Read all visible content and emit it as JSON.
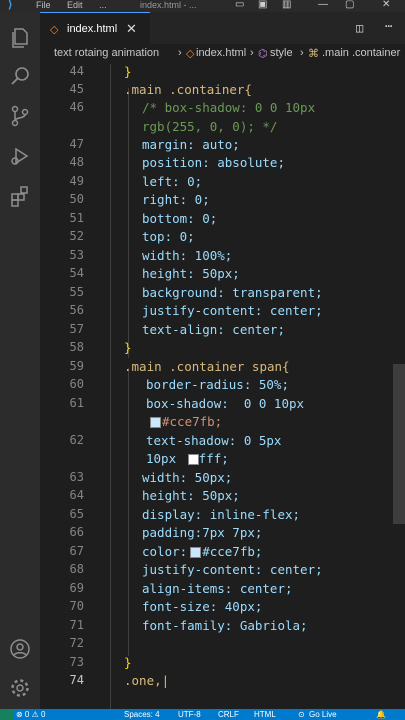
{
  "titlebar": {
    "menu": [
      "File",
      "Edit",
      "..."
    ],
    "window_title": "index.html - ..."
  },
  "tabs": [
    {
      "label": "index.html",
      "close": "✕"
    }
  ],
  "breadcrumb": [
    "text rotaing animation",
    "index.html",
    "style",
    ".main .container"
  ],
  "editor": {
    "lines": [
      {
        "n": "44",
        "text": "}"
      },
      {
        "n": "45",
        "text": ".main .container{"
      },
      {
        "n": "46",
        "text": "/* box-shadow: 0 0 10px"
      },
      {
        "n": "",
        "text": "rgb(255, 0, 0); */"
      },
      {
        "n": "47",
        "text": "margin: auto;"
      },
      {
        "n": "48",
        "text": "position: absolute;"
      },
      {
        "n": "49",
        "text": "left: 0;"
      },
      {
        "n": "50",
        "text": "right: 0;"
      },
      {
        "n": "51",
        "text": "bottom: 0;"
      },
      {
        "n": "52",
        "text": "top: 0;"
      },
      {
        "n": "53",
        "text": "width: 100%;"
      },
      {
        "n": "54",
        "text": "height: 50px;"
      },
      {
        "n": "55",
        "text": "background: transparent;"
      },
      {
        "n": "56",
        "text": "justify-content: center;"
      },
      {
        "n": "57",
        "text": "text-align: center;"
      },
      {
        "n": "58",
        "text": "}"
      },
      {
        "n": "59",
        "text": ".main .container span{"
      },
      {
        "n": "60",
        "text": "border-radius: 50%;"
      },
      {
        "n": "61",
        "text": "box-shadow:  0 0 10px"
      },
      {
        "n": "",
        "text": "#cce7fb;"
      },
      {
        "n": "62",
        "text": "text-shadow: 0 5px"
      },
      {
        "n": "",
        "text": "10px  #fff;"
      },
      {
        "n": "63",
        "text": "width: 50px;"
      },
      {
        "n": "64",
        "text": "height: 50px;"
      },
      {
        "n": "65",
        "text": "display: inline-flex;"
      },
      {
        "n": "66",
        "text": "padding:7px 7px;"
      },
      {
        "n": "67",
        "text": "color:  #cce7fb;"
      },
      {
        "n": "68",
        "text": "justify-content: center;"
      },
      {
        "n": "69",
        "text": "align-items: center;"
      },
      {
        "n": "70",
        "text": "font-size: 40px;"
      },
      {
        "n": "71",
        "text": "font-family: Gabriola;"
      },
      {
        "n": "72",
        "text": ""
      },
      {
        "n": "73",
        "text": "}"
      },
      {
        "n": "74",
        "text": ".one,|"
      }
    ],
    "current_line": "74",
    "swatch_colors": {
      "cce7fb": "#cce7fb",
      "fff": "#ffffff"
    }
  },
  "statusbar": {
    "problems": "⊗ 0 ⚠ 0",
    "spaces": "Spaces: 4",
    "encoding": "UTF-8",
    "eol": "CRLF",
    "language": "HTML",
    "live": "Go Live"
  },
  "colors": {
    "accent": "#007acc",
    "selector": "#d7ba7d",
    "property": "#9cdcfe",
    "value": "#ce9178",
    "number": "#b5cea8",
    "comment": "#6a9955"
  }
}
